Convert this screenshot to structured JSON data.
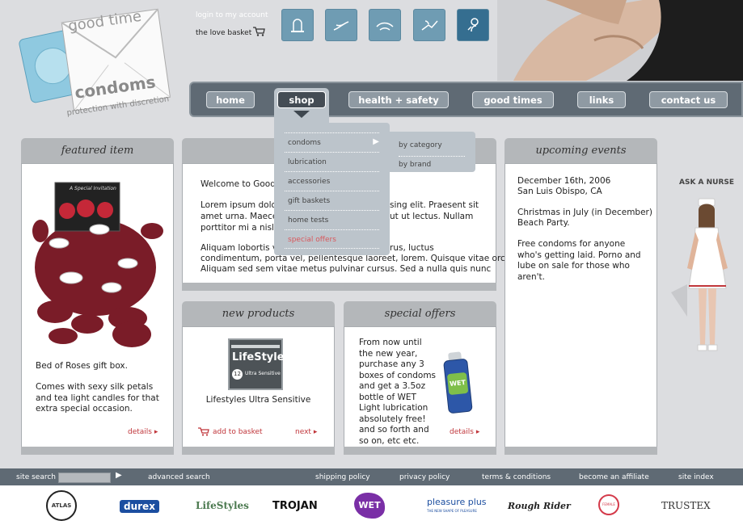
{
  "brand": {
    "name_top": "good time",
    "name_main": "condoms",
    "tagline": "protection with discretion"
  },
  "header": {
    "login": "login to my account",
    "basket": "the love basket"
  },
  "category_icons": [
    "condom-icon",
    "lubrication-icon",
    "accessories-icon",
    "gift-icon",
    "test-icon"
  ],
  "nav": {
    "items": [
      "home",
      "shop",
      "health + safety",
      "good times",
      "links",
      "contact us"
    ],
    "active": "shop"
  },
  "shop_menu": {
    "items": [
      "condoms",
      "lubrication",
      "accessories",
      "gift baskets",
      "home tests",
      "special offers"
    ],
    "sub_items": [
      "by category",
      "by brand"
    ]
  },
  "featured": {
    "heading": "featured item",
    "caption": "Bed of Roses gift box.",
    "description": "Comes with sexy silk petals and tea light candles for that extra special occasion.",
    "link": "details",
    "box_text": "A Special Invitation"
  },
  "welcome": {
    "p1": "Welcome to Good T",
    "p2a": "Lorem ipsum dolor",
    "p2b": "sing elit. Praesent sit",
    "p2c": "amet urna. Maecen",
    "p2d": "ut ut lectus. Nullam",
    "p2e": "porttitor mi a nisl im",
    "p3a": "Aliquam lobortis ve",
    "p3b": "rus, luctus",
    "p3c": "condimentum, porta vel, pellentesque laoreet, lorem. Quisque vitae orci.",
    "p3d": "Aliquam sed sem vitae metus pulvinar cursus. Sed a nulla quis nunc"
  },
  "new_products": {
    "heading": "new products",
    "product": "Lifestyles Ultra Sensitive",
    "box_brand": "LifeStyles",
    "box_sub": "Ultra Sensitive",
    "box_count": "12",
    "add": "add to basket",
    "next": "next"
  },
  "special_offers": {
    "heading": "special offers",
    "text": "From now until the new year, purchase any 3 boxes of condoms and get a 3.5oz bottle of WET Light lubrication absolutely free! and so forth and so on, etc etc.",
    "bottle": "WET",
    "link": "details"
  },
  "events": {
    "heading": "upcoming events",
    "e1a": "December 16th, 2006",
    "e1b": "San Luis Obispo, CA",
    "e2a": "Christmas in July (in December)",
    "e2b": "Beach Party.",
    "e3": "Free condoms for anyone who's getting laid.  Porno and lube on sale for those who aren't."
  },
  "nurse": {
    "label": "ASK A NURSE"
  },
  "footer": {
    "search": "site search",
    "advanced": "advanced search",
    "links": [
      "shipping policy",
      "privacy policy",
      "terms & conditions",
      "become an affiliate",
      "site index"
    ]
  },
  "brands": [
    "ATLAS",
    "durex",
    "LifeStyles",
    "TROJAN",
    "WET",
    "pleasure plus",
    "Rough Rider",
    "FEMALE CONDOM",
    "TRUSTEX"
  ],
  "brands_extra": {
    "pleasure_sub": "THE NEW SHAPE OF PLEASURE"
  },
  "colors": {
    "accent_blue": "#6f9cb3",
    "nav_gray": "#5f6a74",
    "red_link": "#c0363b"
  }
}
